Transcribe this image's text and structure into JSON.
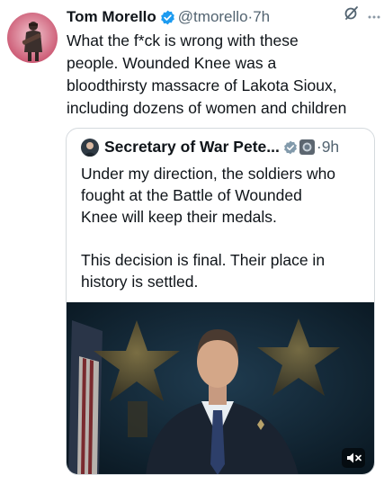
{
  "tweet": {
    "author_name": "Tom Morello",
    "handle": "@tmorello",
    "separator": "·",
    "time": "7h",
    "text_lines": [
      "What the f*ck is wrong with these",
      "people. Wounded Knee was a",
      "bloodthirsty massacre of Lakota Sioux,",
      "including dozens of women and children"
    ]
  },
  "quote": {
    "author_name": "Secretary of War Pete...",
    "separator": "·",
    "time": "9h",
    "paragraph1_lines": [
      "Under my direction, the soldiers who",
      "fought at the Battle of Wounded",
      "Knee will keep their medals."
    ],
    "paragraph2_lines": [
      "This decision is final. Their place in",
      "history is settled."
    ]
  },
  "icons": {
    "verified": "verified-badge-icon",
    "grok": "grok-icon",
    "more": "more-icon",
    "government": "government-badge-icon",
    "mute": "mute-icon"
  },
  "colors": {
    "verified_blue": "#1d9bf0",
    "secondary_text": "#536471",
    "border": "#d5dade"
  }
}
